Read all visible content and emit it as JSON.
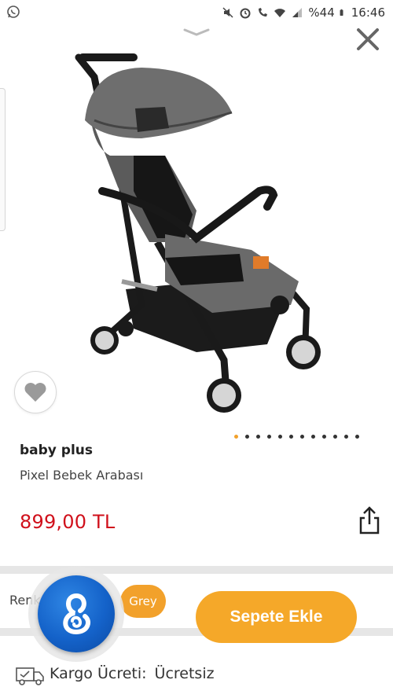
{
  "status_bar": {
    "battery": "%44",
    "time": "16:46"
  },
  "product": {
    "brand": "baby plus",
    "name": "Pixel Bebek Arabası",
    "price": "899,00 TL",
    "image_pages": 12,
    "active_image": 1
  },
  "options": {
    "color_label": "Renk",
    "selected_color": "Grey"
  },
  "actions": {
    "add_to_cart": "Sepete Ekle"
  },
  "shipping": {
    "label": "Kargo Ücreti:",
    "value": "Ücretsiz"
  },
  "colors": {
    "accent": "#f5a829",
    "price": "#d0101b",
    "fab": "#1462c9"
  },
  "icons": [
    "whatsapp-icon",
    "mute-icon",
    "alarm-icon",
    "wifi-call-icon",
    "wifi-icon",
    "signal-icon",
    "battery-icon",
    "chevron-down-icon",
    "close-icon",
    "heart-icon",
    "share-icon",
    "assistant-icon",
    "shipping-truck-icon"
  ]
}
